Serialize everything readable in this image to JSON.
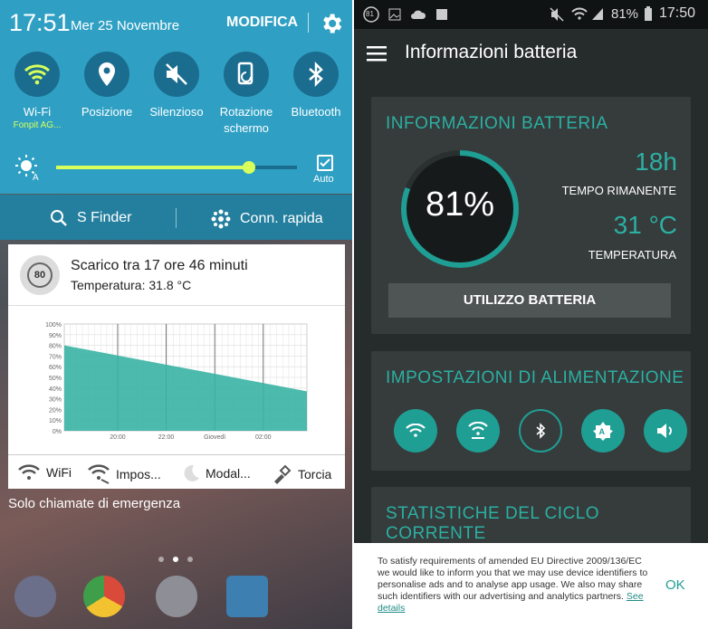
{
  "left": {
    "clock": "17:51",
    "date": "Mer 25 Novembre",
    "modifica": "MODIFICA",
    "tiles": [
      {
        "label": "Wi-Fi",
        "sub": "Fonpit AG...",
        "icon": "wifi-icon"
      },
      {
        "label": "Posizione",
        "sub": "",
        "icon": "location-icon"
      },
      {
        "label": "Silenzioso",
        "sub": "",
        "icon": "mute-icon"
      },
      {
        "label": "Rotazione schermo",
        "sub": "",
        "icon": "rotation-icon"
      },
      {
        "label": "Bluetooth",
        "sub": "",
        "icon": "bluetooth-icon"
      }
    ],
    "brightness_level": 0.8,
    "auto_label": "Auto",
    "sfinder": "S Finder",
    "conn": "Conn. rapida",
    "notification": {
      "badge": "80",
      "title": "Scarico tra 17 ore 46 minuti",
      "subtitle": "Temperatura: 31.8 °C"
    },
    "toggles": [
      "WiFi",
      "Impos...",
      "Modal...",
      "Torcia"
    ],
    "emergency": "Solo chiamate di emergenza"
  },
  "chart_data": {
    "type": "area",
    "y_ticks": [
      "100%",
      "90%",
      "80%",
      "70%",
      "60%",
      "50%",
      "40%",
      "30%",
      "20%",
      "10%",
      "0%"
    ],
    "x_ticks": [
      "20:00",
      "22:00",
      "Giovedì",
      "02:00"
    ],
    "ylim": [
      0,
      100
    ],
    "start_value": 80,
    "end_value": 37,
    "color": "#39b3a3"
  },
  "right": {
    "status": {
      "battery": "81%",
      "time": "17:50",
      "badge": "81"
    },
    "title": "Informazioni batteria",
    "info": {
      "header": "INFORMAZIONI BATTERIA",
      "percent": "81%",
      "percent_value": 81,
      "time_left": "18h",
      "time_left_label": "TEMPO RIMANENTE",
      "temp": "31 °C",
      "temp_label": "TEMPERATURA",
      "usage_btn": "UTILIZZO BATTERIA"
    },
    "power": {
      "header": "IMPOSTAZIONI DI ALIMENTAZIONE"
    },
    "stats": {
      "header": "STATISTICHE DEL CICLO CORRENTE"
    },
    "consent": {
      "text": "To satisfy requirements of amended EU Directive 2009/136/EC we would like to inform you that we may use device identifiers to personalise ads and to analyse app usage. We also may share such identifiers with our advertising and analytics partners.",
      "link": "See details",
      "ok": "OK"
    },
    "accent": "#2bb0a2"
  }
}
